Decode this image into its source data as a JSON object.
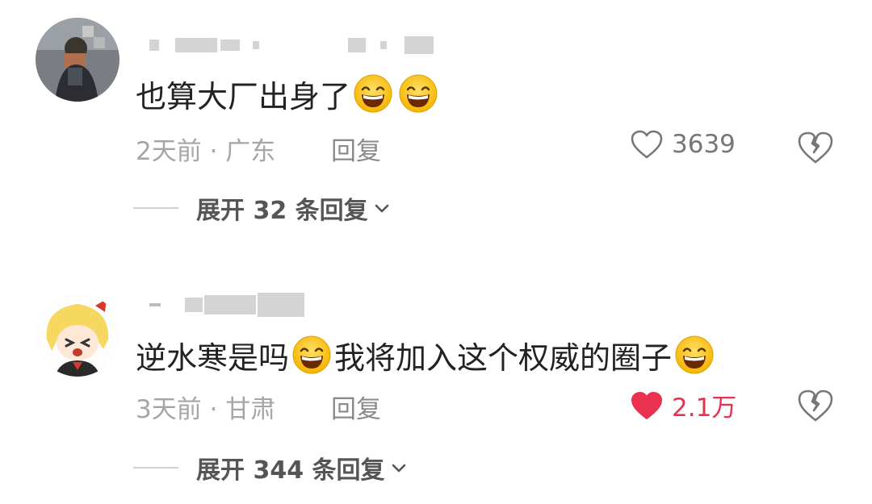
{
  "comments": [
    {
      "text_prefix": "也算大厂出身了",
      "text_suffix": "",
      "text_middle": "",
      "meta": "2天前 · 广东",
      "reply_label": "回复",
      "like_count": "3639",
      "liked": false,
      "expand_label": "展开 32 条回复"
    },
    {
      "text_prefix": "逆水寒是吗",
      "text_middle": "我将加入这个权威的圈子",
      "text_suffix": "",
      "meta": "3天前 · 甘肃",
      "reply_label": "回复",
      "like_count": "2.1万",
      "liked": true,
      "expand_label": "展开 344 条回复"
    }
  ],
  "colors": {
    "like_active": "#e8324f",
    "text": "#222222",
    "meta": "#a6a6a6"
  },
  "icons": [
    "grinning-emoji-icon",
    "heart-outline-icon",
    "heart-filled-icon",
    "broken-heart-icon",
    "chevron-down-icon"
  ]
}
